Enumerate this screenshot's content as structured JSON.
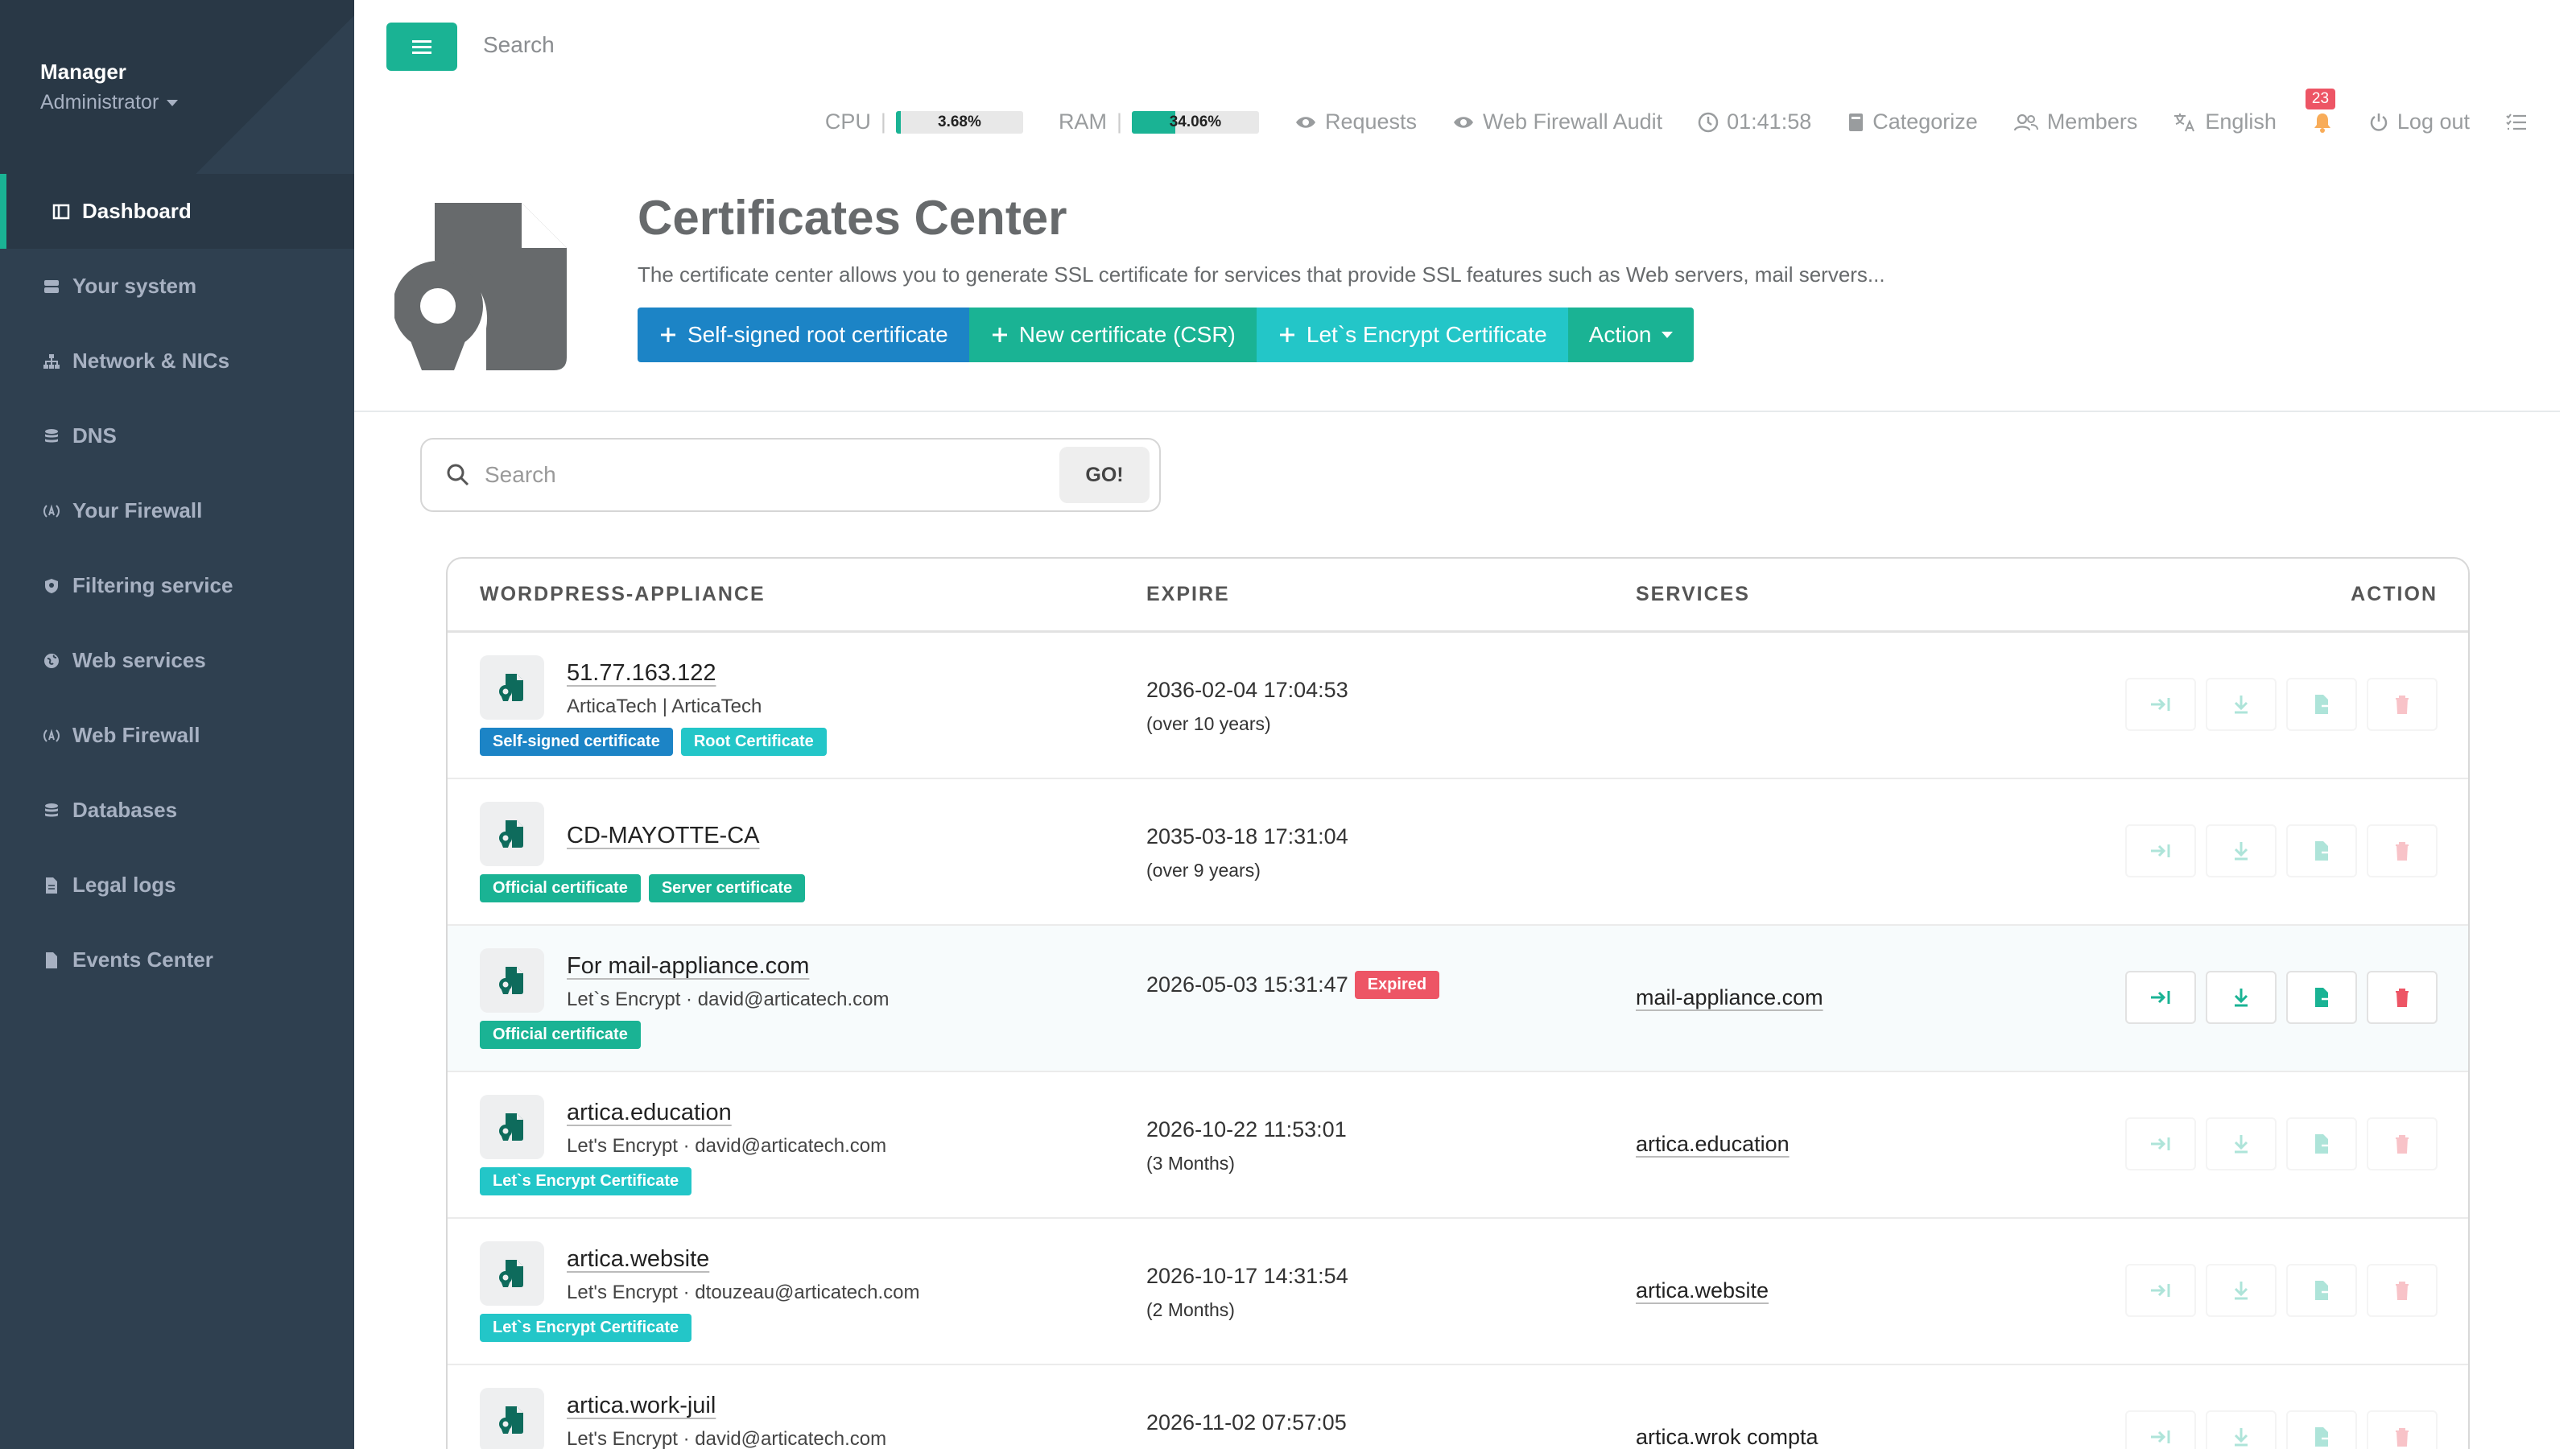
{
  "sidebar": {
    "profile": {
      "name": "Manager",
      "role": "Administrator"
    },
    "items": [
      {
        "label": "Dashboard",
        "icon": "dashboard-icon",
        "active": true
      },
      {
        "label": "Your system",
        "icon": "server-icon"
      },
      {
        "label": "Network & NICs",
        "icon": "network-icon"
      },
      {
        "label": "DNS",
        "icon": "database-icon"
      },
      {
        "label": "Your Firewall",
        "icon": "firewall-icon"
      },
      {
        "label": "Filtering service",
        "icon": "shield-icon"
      },
      {
        "label": "Web services",
        "icon": "globe-icon"
      },
      {
        "label": "Web Firewall",
        "icon": "firewall-icon"
      },
      {
        "label": "Databases",
        "icon": "database-icon"
      },
      {
        "label": "Legal logs",
        "icon": "file-icon"
      },
      {
        "label": "Events Center",
        "icon": "file-icon"
      }
    ]
  },
  "topbar": {
    "search_placeholder": "Search",
    "cpu": {
      "label": "CPU",
      "value": "3.68%",
      "fraction": 0.0368
    },
    "ram": {
      "label": "RAM",
      "value": "34.06%",
      "fraction": 0.3406
    },
    "requests": "Requests",
    "web_firewall_audit": "Web Firewall Audit",
    "time": "01:41:58",
    "categorize": "Categorize",
    "members": "Members",
    "language": "English",
    "notifications": "23",
    "logout": "Log out"
  },
  "header": {
    "title": "Certificates Center",
    "description": "The certificate center allows you to generate SSL certificate for services that provide SSL features such as Web servers, mail servers...",
    "buttons": {
      "self_signed": "Self-signed root certificate",
      "new_csr": "New certificate (CSR)",
      "letsencrypt": "Let`s Encrypt Certificate",
      "action": "Action"
    }
  },
  "search": {
    "placeholder": "Search",
    "go": "GO!"
  },
  "table": {
    "headers": {
      "name": "WORDPRESS-APPLIANCE",
      "expire": "EXPIRE",
      "services": "SERVICES",
      "action": "ACTION"
    },
    "rows": [
      {
        "name": "51.77.163.122",
        "sub": "ArticaTech | ArticaTech",
        "tags": [
          {
            "label": "Self-signed certificate",
            "color": "blue"
          },
          {
            "label": "Root Certificate",
            "color": "teal"
          }
        ],
        "expire": "2036-02-04 17:04:53",
        "relative": "(over 10 years)",
        "expired": false,
        "service": "",
        "highlight": false
      },
      {
        "name": "CD-MAYOTTE-CA",
        "sub": "",
        "tags": [
          {
            "label": "Official certificate",
            "color": "green"
          },
          {
            "label": "Server certificate",
            "color": "green"
          }
        ],
        "expire": "2035-03-18 17:31:04",
        "relative": "(over 9 years)",
        "expired": false,
        "service": "",
        "highlight": false
      },
      {
        "name": "For mail-appliance.com",
        "sub": "Let`s Encrypt · david@articatech.com",
        "tags": [
          {
            "label": "Official certificate",
            "color": "green"
          }
        ],
        "expire": "2026-05-03 15:31:47",
        "relative": "",
        "expired": true,
        "expired_label": "Expired",
        "service": "mail-appliance.com",
        "highlight": true
      },
      {
        "name": "artica.education",
        "sub": "Let's Encrypt · david@articatech.com",
        "tags": [
          {
            "label": "Let`s Encrypt Certificate",
            "color": "teal"
          }
        ],
        "expire": "2026-10-22 11:53:01",
        "relative": "(3 Months)",
        "expired": false,
        "service": "artica.education",
        "highlight": false
      },
      {
        "name": "artica.website",
        "sub": "Let's Encrypt · dtouzeau@articatech.com",
        "tags": [
          {
            "label": "Let`s Encrypt Certificate",
            "color": "teal"
          }
        ],
        "expire": "2026-10-17 14:31:54",
        "relative": "(2 Months)",
        "expired": false,
        "service": "artica.website",
        "highlight": false
      },
      {
        "name": "artica.work-juil",
        "sub": "Let's Encrypt · david@articatech.com",
        "tags": [],
        "expire": "2026-11-02 07:57:05",
        "relative": "",
        "expired": false,
        "service": "artica.wrok compta",
        "highlight": false
      }
    ]
  },
  "colors": {
    "sidebar": "#2f4050",
    "accent": "#1ab394",
    "primary": "#1c84c6",
    "info": "#23c6c8",
    "danger": "#ed5565"
  }
}
